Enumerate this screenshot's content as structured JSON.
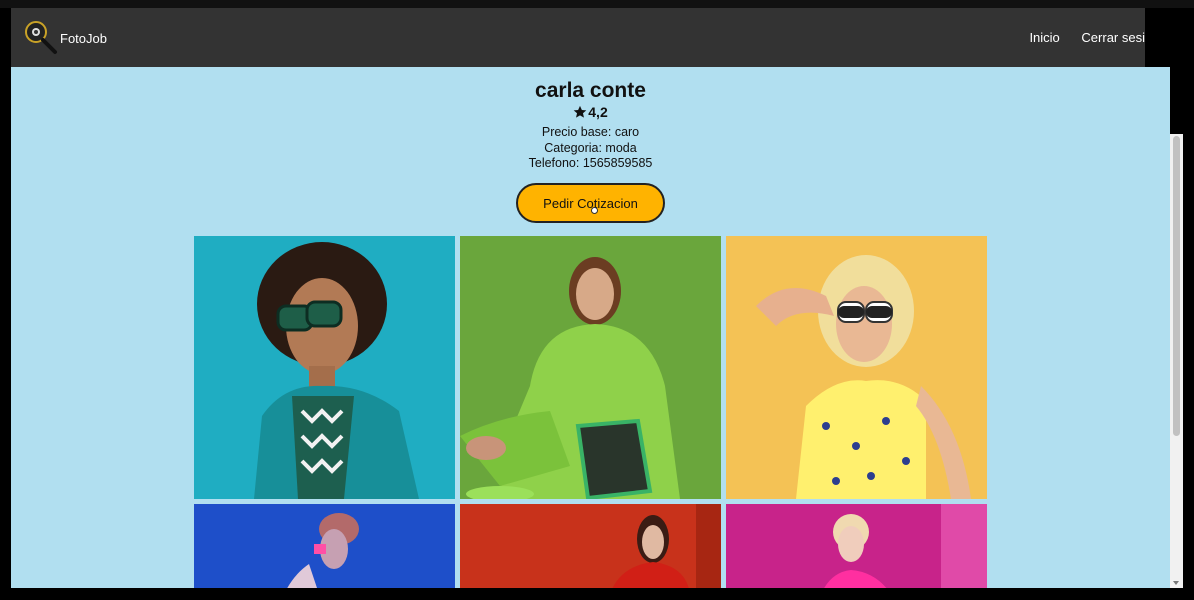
{
  "navbar": {
    "brand": "FotoJob",
    "logo_icon": "magnifier-camera-icon",
    "links": [
      "Inicio",
      "Cerrar sesi"
    ]
  },
  "profile": {
    "name": "carla conte",
    "rating": "4,2",
    "rating_icon": "star-icon",
    "precio": "Precio base: caro",
    "categoria": "Categoria: moda",
    "telefono": "Telefono: 1565859585"
  },
  "cta": {
    "label": "Pedir Cotizacion"
  },
  "gallery": {
    "photos": [
      {
        "name": "photo-woman-teal-jacket",
        "bg": "#1aa6bb"
      },
      {
        "name": "photo-woman-green-outfit",
        "bg": "#6aa63c"
      },
      {
        "name": "photo-woman-yellow-dress",
        "bg": "#f4c255"
      },
      {
        "name": "photo-woman-blue-backdrop",
        "bg": "#1e4fc9"
      },
      {
        "name": "photo-woman-red-backdrop",
        "bg": "#c8321b"
      },
      {
        "name": "photo-woman-magenta-backdrop",
        "bg": "#c8238a"
      }
    ]
  },
  "colors": {
    "navbar": "#333333",
    "page_background": "#b1dff0",
    "button": "#ffb300"
  }
}
